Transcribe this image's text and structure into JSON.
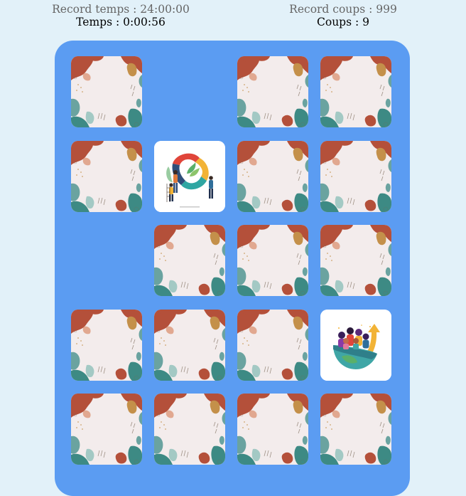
{
  "stats": {
    "record_time_label": "Record temps : 24:00:00",
    "time_label": "Temps : 0:00:56",
    "record_moves_label": "Record coups : 999",
    "moves_label": "Coups : 9"
  },
  "colors": {
    "page_background": "#e2f1f9",
    "board_background": "#5b9cf2",
    "card_back_base": "#f3ecec"
  },
  "board": {
    "rows": [
      [
        "back",
        "empty",
        "back",
        "back"
      ],
      [
        "back",
        "face-teamwork-puzzle",
        "back",
        "back"
      ],
      [
        "empty",
        "back",
        "back",
        "back"
      ],
      [
        "back",
        "back",
        "back",
        "face-team-growth"
      ],
      [
        "back",
        "back",
        "back",
        "back"
      ]
    ]
  }
}
